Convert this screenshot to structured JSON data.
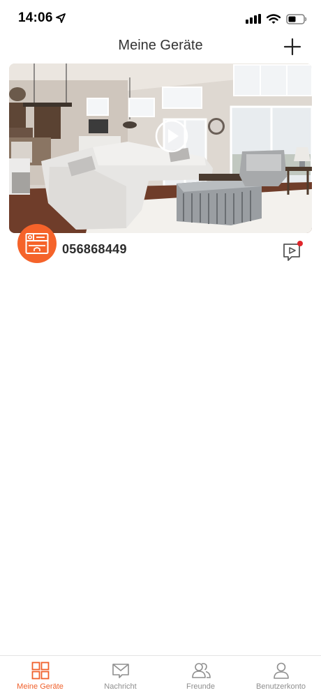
{
  "status_bar": {
    "time": "14:06",
    "icons": [
      "location-arrow-icon",
      "signal-icon",
      "wifi-icon",
      "battery-icon"
    ]
  },
  "header": {
    "title": "Meine Geräte",
    "add_icon": "plus-icon"
  },
  "devices": [
    {
      "name": "056868449",
      "avatar_icon": "doorbell-device-icon",
      "preview_icon": "play-icon",
      "recordings_icon": "video-message-icon",
      "has_new_recording": true
    }
  ],
  "tabs": [
    {
      "label": "Meine Geräte",
      "icon": "grid-icon",
      "active": true
    },
    {
      "label": "Nachricht",
      "icon": "envelope-icon",
      "active": false
    },
    {
      "label": "Freunde",
      "icon": "friends-icon",
      "active": false
    },
    {
      "label": "Benutzerkonto",
      "icon": "user-icon",
      "active": false
    }
  ],
  "colors": {
    "accent": "#f0602b",
    "avatar_bg": "#f5632a",
    "notification_dot": "#e0262b",
    "inactive_tab": "#8e8e8e"
  }
}
